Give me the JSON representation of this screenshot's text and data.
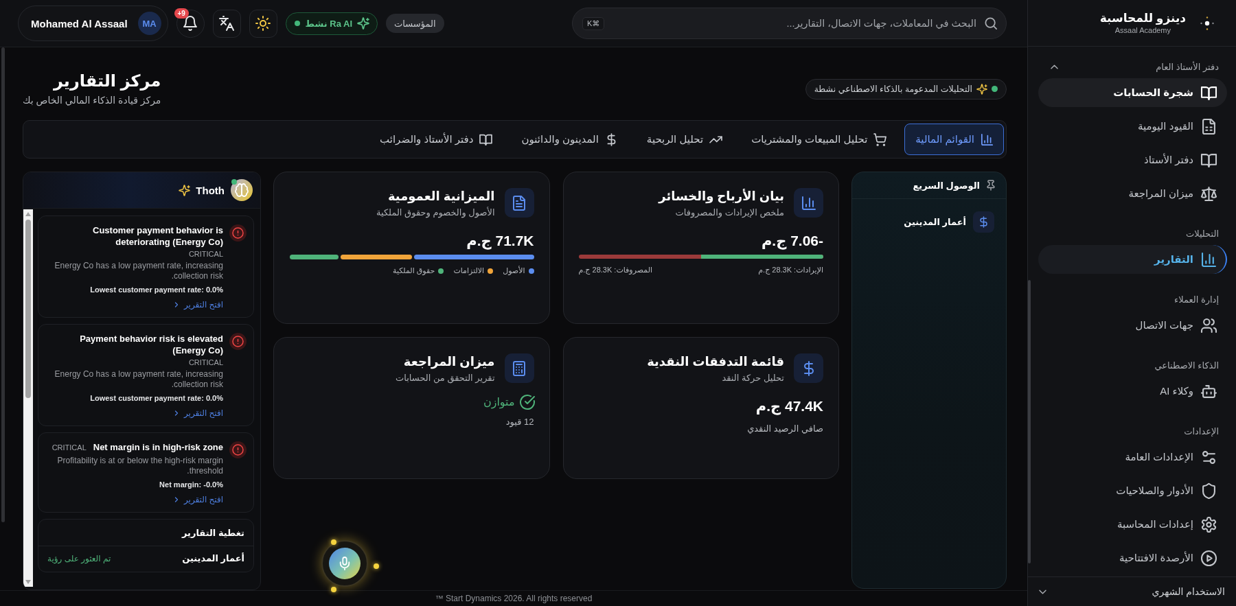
{
  "sidebar": {
    "brand": {
      "name": "دينزو للمحاسبة",
      "subtitle": "Assaal Academy"
    },
    "sections": [
      {
        "label": "دفتر الأستاذ العام",
        "expanded": true,
        "items": [
          {
            "label": "شجرة الحسابات",
            "selected": false,
            "highlighted": true
          },
          {
            "label": "القيود اليومية",
            "selected": false,
            "highlighted": false
          },
          {
            "label": "دفتر الأستاذ",
            "selected": false,
            "highlighted": false
          },
          {
            "label": "ميزان المراجعة",
            "selected": false,
            "highlighted": false
          }
        ]
      },
      {
        "label": "التحليلات",
        "items": [
          {
            "label": "التقارير",
            "selected": true,
            "highlighted": false
          }
        ]
      },
      {
        "label": "إدارة العملاء",
        "items": [
          {
            "label": "جهات الاتصال",
            "selected": false,
            "highlighted": false
          }
        ]
      },
      {
        "label": "الذكاء الاصطناعي",
        "items": [
          {
            "label": "وكلاء AI",
            "selected": false,
            "highlighted": false
          }
        ]
      },
      {
        "label": "الإعدادات",
        "items": [
          {
            "label": "الإعدادات العامة",
            "selected": false,
            "highlighted": false
          },
          {
            "label": "الأدوار والصلاحيات",
            "selected": false,
            "highlighted": false
          },
          {
            "label": "إعدادات المحاسبة",
            "selected": false,
            "highlighted": false
          },
          {
            "label": "الأرصدة الافتتاحية",
            "selected": false,
            "highlighted": false
          }
        ]
      }
    ],
    "usage": {
      "label": "الاستخدام الشهري",
      "expanded": false
    }
  },
  "topbar": {
    "search": {
      "placeholder": "البحث في المعاملات، جهات الاتصال، التقارير...",
      "shortcut": "⌘K"
    },
    "organizations": "المؤسسات",
    "ai_status": {
      "label": "Ra AI نشط",
      "on": true
    },
    "notifications": {
      "badge": "+9"
    },
    "user": {
      "name": "Mohamed Al Assaal",
      "initials": "MA"
    }
  },
  "page": {
    "title": "مركز التقارير",
    "subtitle": "مركز قيادة الذكاء المالي الخاص بك",
    "ai_badge": {
      "label": "التحليلات المدعومة بالذكاء الاصطناعي نشطة",
      "on": true
    }
  },
  "tabs": [
    {
      "label": "القوائم المالية",
      "selected": true
    },
    {
      "label": "تحليل المبيعات والمشتريات",
      "selected": false
    },
    {
      "label": "تحليل الربحية",
      "selected": false
    },
    {
      "label": "المدينون والدائنون",
      "selected": false
    },
    {
      "label": "دفتر الأستاذ والضرائب",
      "selected": false
    }
  ],
  "quick_access": {
    "title": "الوصول السريع",
    "items": [
      {
        "label": "أعمار المدينين"
      }
    ]
  },
  "report_cards": [
    {
      "kind": "split",
      "title": "بيان الأرباح والخسائر",
      "subtitle": "ملخص الإيرادات والمصروفات",
      "value": "-7.06 ج.م",
      "bar": {
        "level": 0.5
      },
      "labels": [
        "الإيرادات: 28.3K ج.م",
        "المصروفات: 28.3K ج.م"
      ]
    },
    {
      "kind": "segments",
      "title": "الميزانية العمومية",
      "subtitle": "الأصول والخصوم وحقوق الملكية",
      "value": "71.7K ج.م",
      "segments": [
        {
          "label": "الأصول",
          "color": "#5b8def",
          "level": 0.49
        },
        {
          "label": "الالتزامات",
          "color": "#f0a43a",
          "level": 0.29
        },
        {
          "label": "حقوق الملكية",
          "color": "#4fb37a",
          "level": 0.2
        }
      ]
    },
    {
      "kind": "metric",
      "title": "قائمة التدفقات النقدية",
      "subtitle": "تحليل حركة النقد",
      "value": "47.4K ج.م",
      "caption": "صافي الرصيد النقدي"
    },
    {
      "kind": "status",
      "title": "ميزان المراجعة",
      "subtitle": "تقرير التحقق من الحسابات",
      "status": "متوازن",
      "balanced": true,
      "caption": "12 قيود"
    }
  ],
  "thoth": {
    "title": "Thoth",
    "online": true,
    "alerts": [
      {
        "title": "Customer payment behavior is deteriorating (Energy Co)",
        "severity": "CRITICAL",
        "description": "Energy Co has a low payment rate, increasing collection risk.",
        "metric": "Lowest customer payment rate: 0.0%",
        "link": "افتح التقرير"
      },
      {
        "title": "Payment behavior risk is elevated (Energy Co)",
        "severity": "CRITICAL",
        "description": "Energy Co has a low payment rate, increasing collection risk.",
        "metric": "Lowest customer payment rate: 0.0%",
        "link": "افتح التقرير"
      },
      {
        "title": "Net margin is in high-risk zone",
        "severity": "CRITICAL",
        "description": "Profitability is at or below the high-risk margin threshold.",
        "metric": "Net margin: -0.0%",
        "link": "افتح التقرير"
      }
    ],
    "coverage": {
      "title": "تغطية التقارير",
      "rows": [
        {
          "label": "أعمار المدينين",
          "status": "تم العثور على رؤية"
        }
      ]
    }
  },
  "footer": "™ Start Dynamics 2026. All rights reserved"
}
